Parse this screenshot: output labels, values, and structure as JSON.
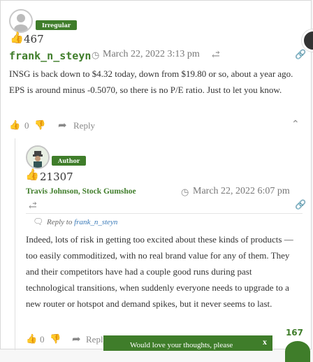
{
  "comment1": {
    "badge": "Irregular",
    "score": "467",
    "author": "frank_n_steyn",
    "date": "March 22, 2022 3:13 pm",
    "body": "INSG is back down to $4.32 today, down from $19.80 or so, about a year ago. EPS is around minus -0.5070, so there is no P/E ratio. Just to let you know.",
    "likes": "0",
    "reply_label": "Reply"
  },
  "comment2": {
    "badge": "Author",
    "score": "21307",
    "author": "Travis Johnson, Stock Gumshoe",
    "date": "March 22, 2022 6:07 pm",
    "reply_to_label": "Reply to",
    "reply_to_user": "frank_n_steyn",
    "body": "Indeed, lots of risk in getting too excited about these kinds of products — too easily commoditized, with no real brand value for any of them. They and their competitors have had a couple good runs during past technological transitions, when suddenly everyone needs to upgrade to a new router or hotspot and demand spikes, but it never seems to last.",
    "likes": "0",
    "reply_label": "Reply"
  },
  "popup": {
    "text": "Would love your thoughts, please",
    "close": "x"
  },
  "side_count": "167",
  "colors": {
    "brand_green": "#3f7d2a",
    "link_blue": "#3a7ab8"
  }
}
